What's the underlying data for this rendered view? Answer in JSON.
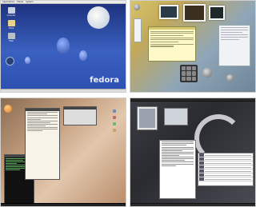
{
  "panels": {
    "fedora": {
      "menu": [
        "Applications",
        "Places",
        "System"
      ],
      "icons": [
        "Computer",
        "Home",
        "Trash"
      ],
      "logo": "fedora"
    }
  }
}
